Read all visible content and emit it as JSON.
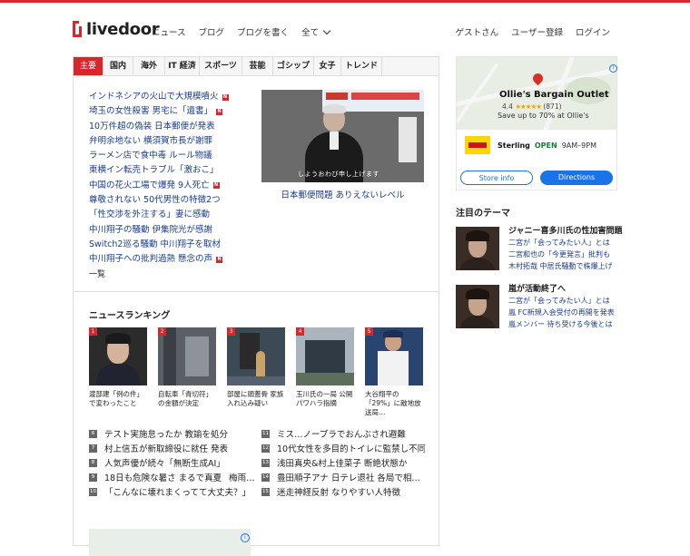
{
  "header": {
    "logo": "livedoor",
    "nav": [
      "ニュース",
      "ブログ",
      "ブログを書く",
      "全て"
    ],
    "user_nav": [
      "ゲストさん",
      "ユーザー登録",
      "ログイン"
    ]
  },
  "categories": [
    "主要",
    "国内",
    "海外",
    "IT 経済",
    "スポーツ",
    "芸能",
    "ゴシップ",
    "女子",
    "トレンド"
  ],
  "headlines": [
    {
      "text": "インドネシアの火山で大規模噴火",
      "new": "N"
    },
    {
      "text": "埼玉の女性殺害 男宅に「遺書」",
      "new": "N"
    },
    {
      "text": "10万件超の偽装 日本郵便が発表",
      "new": ""
    },
    {
      "text": "弁明余地ない 横須賀市長が謝罪",
      "new": ""
    },
    {
      "text": "ラーメン店で食中毒 ルール物議",
      "new": ""
    },
    {
      "text": "東横イン転売トラブル「激おこ」",
      "new": ""
    },
    {
      "text": "中国の花火工場で爆発 9人死亡",
      "new": "N"
    },
    {
      "text": "尊敬されない 50代男性の特徴2つ",
      "new": ""
    },
    {
      "text": "「性交渉を外注する」妻に感動",
      "new": ""
    },
    {
      "text": "中川翔子の騒動 伊集院光が感謝",
      "new": ""
    },
    {
      "text": "Switch2巡る騒動 中川翔子を取材",
      "new": ""
    },
    {
      "text": "中川翔子への批判過熱 懸念の声",
      "new": "N"
    }
  ],
  "more_label": "一覧",
  "feature": {
    "caption": "日本郵便問題 ありえないレベル",
    "image_subtitle": "しようおわび申し上げます"
  },
  "ranking": {
    "title": "ニュースランキング",
    "cards": [
      {
        "num": "1",
        "caption": "渡部建「例の件」で変わったこと"
      },
      {
        "num": "2",
        "caption": "自転車「青切符」の金額が決定"
      },
      {
        "num": "3",
        "caption": "部屋に頭蓋骨 家族入れ込み疑い"
      },
      {
        "num": "4",
        "caption": "玉川氏の一局 公開パワハラ指摘"
      },
      {
        "num": "5",
        "caption": "大谷翔平の「29%」に敵地放送局…"
      }
    ],
    "list": [
      {
        "num": "6",
        "text": "テスト実施怠ったか 教諭を処分"
      },
      {
        "num": "7",
        "text": "村上信五が新取締役に就任 発表"
      },
      {
        "num": "8",
        "text": "人気声優が続々「無断生成AI」"
      },
      {
        "num": "9",
        "text": "18日も危険な暑さ まるで真夏"
      },
      {
        "num": "10",
        "text": "「こんなに壊れまくってて大丈夫？」"
      },
      {
        "num": "11",
        "text": "ミス…ノーブラでおんぶされ避難"
      },
      {
        "num": "12",
        "text": "10代女性を多目的トイレに監禁し不同…"
      },
      {
        "num": "13",
        "text": "浅田真央&村上佳菜子 断絶状態か"
      },
      {
        "num": "14",
        "text": "豊田順子アナ 日テレ退社 各局で相…"
      },
      {
        "num": "15",
        "text": "迷走神経反射 なりやすい人特徴"
      }
    ],
    "list_extra": "梅雨…"
  },
  "ad": {
    "name": "Ollie's Bargain Outlet",
    "rating": "4.4",
    "reviews": "(871)",
    "promo": "Save up to 70% at Ollie's",
    "city": "Sterling",
    "open": "OPEN",
    "hours": "9AM–9PM",
    "store_info": "Store info",
    "directions": "Directions",
    "info_icon": "i"
  },
  "themes": {
    "title": "注目のテーマ",
    "items": [
      {
        "head": "ジャニー喜多川氏の性加害問題",
        "lines": [
          "二宮が「会ってみたい人」とは",
          "二宮和也の「今更発言」批判も",
          "木村拓哉 中居氏騒動で株爆上げ"
        ]
      },
      {
        "head": "嵐が活動終了へ",
        "lines": [
          "二宮が「会ってみたい人」とは",
          "嵐 FC新規入会受付の再開を発表",
          "嵐メンバー 待ち受ける今後とは"
        ]
      }
    ]
  }
}
